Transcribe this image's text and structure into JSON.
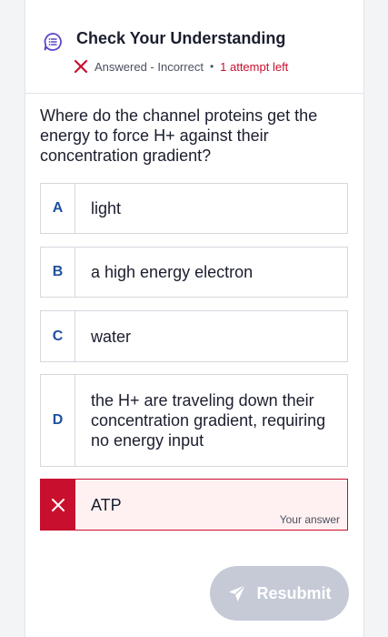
{
  "header": {
    "title": "Check Your Understanding",
    "status_text": "Answered - Incorrect",
    "separator": "•",
    "attempts_text": "1 attempt left"
  },
  "question": "Where do the channel proteins get the energy to force H+ against their concentration gradient?",
  "options": [
    {
      "letter": "A",
      "text": "light"
    },
    {
      "letter": "B",
      "text": "a high energy electron"
    },
    {
      "letter": "C",
      "text": "water"
    },
    {
      "letter": "D",
      "text": "the H+ are traveling down their concentration gradient, requiring no energy input"
    },
    {
      "letter": "",
      "text": "ATP",
      "note": "Your answer",
      "state": "incorrect-selected"
    }
  ],
  "submit": {
    "label": "Resubmit",
    "enabled": false
  },
  "colors": {
    "accent": "#1f4f9e",
    "error": "#c8102e",
    "error_bg": "#fff1f2",
    "icon_purple": "#5b47c9",
    "button_disabled": "#c5cad6"
  },
  "icons": {
    "header": "quiz-list-icon",
    "status": "x-icon",
    "wrong_option": "x-icon",
    "submit": "send-icon"
  }
}
